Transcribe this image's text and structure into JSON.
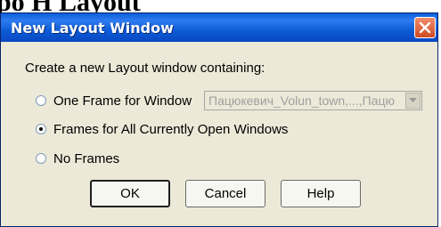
{
  "background": {
    "fragment_text": "ро   Н          Layout"
  },
  "dialog": {
    "title": "New Layout Window",
    "prompt": "Create a new Layout window containing:",
    "options": [
      {
        "label": "One Frame for Window",
        "checked": false
      },
      {
        "label": "Frames for All Currently Open Windows",
        "checked": true
      },
      {
        "label": "No Frames",
        "checked": false
      }
    ],
    "window_select": {
      "value": "Пацюкевич_Volun_town,...,Пацю",
      "disabled": true
    },
    "buttons": {
      "ok": "OK",
      "cancel": "Cancel",
      "help": "Help"
    }
  },
  "colors": {
    "titlebar": "#0a5fdc",
    "dialog_bg": "#ece9d8",
    "close_button": "#d24a22"
  },
  "icons": {
    "close": "close-icon",
    "dropdown": "chevron-down-icon"
  }
}
